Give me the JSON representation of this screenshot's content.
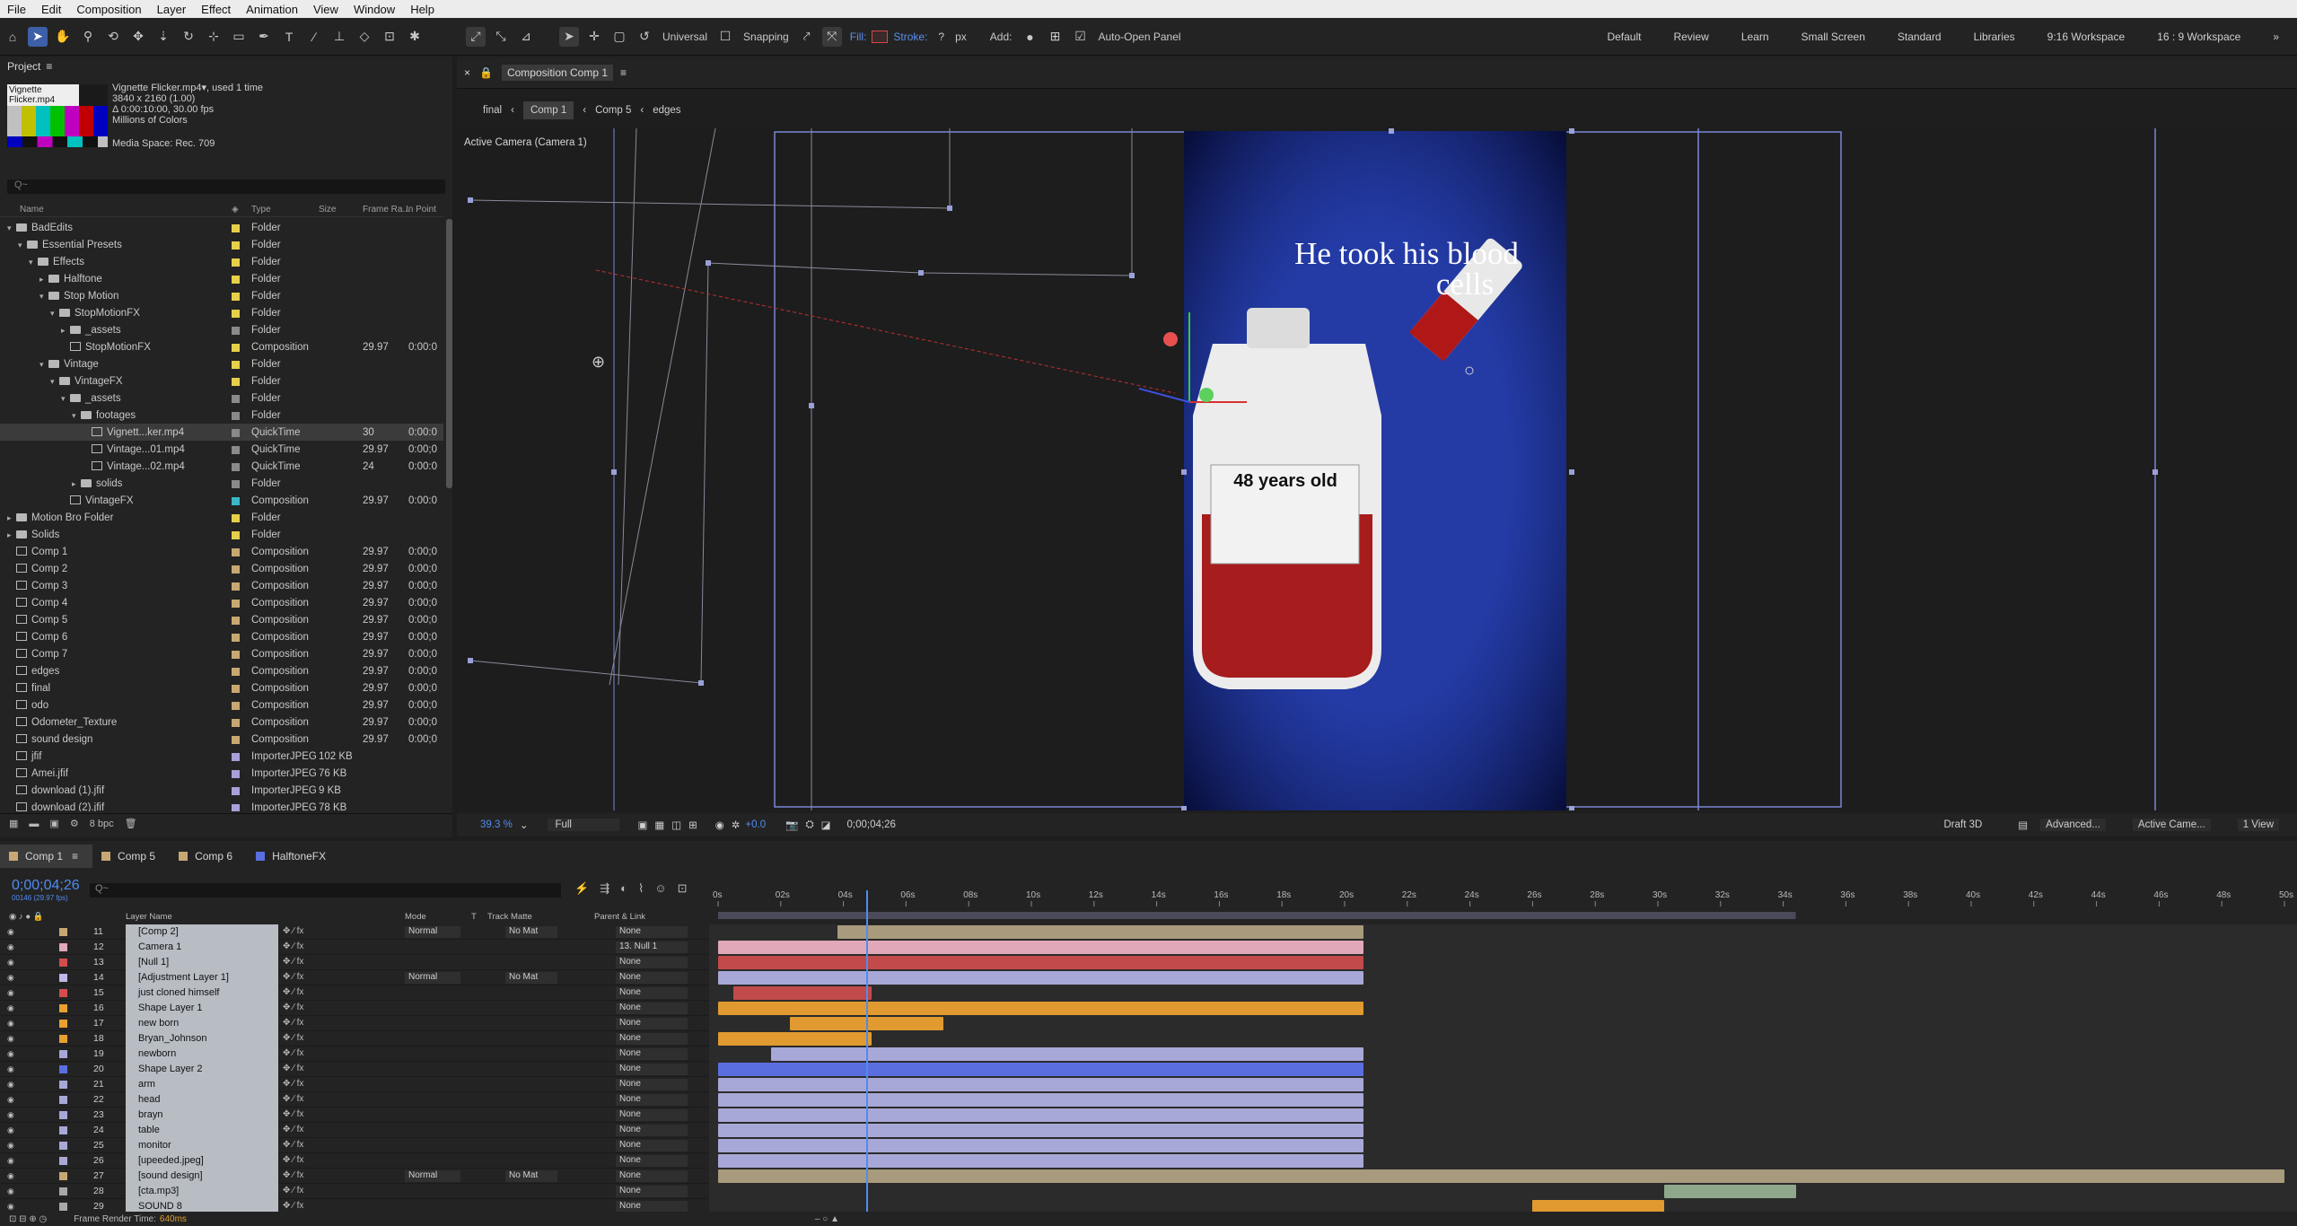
{
  "menu": [
    "File",
    "Edit",
    "Composition",
    "Layer",
    "Effect",
    "Animation",
    "View",
    "Window",
    "Help"
  ],
  "toolbar": {
    "universal": "Universal",
    "snapping": "Snapping",
    "fill": "Fill:",
    "stroke": "Stroke:",
    "stroke_val": "?",
    "px": "px",
    "add": "Add:",
    "auto_open": "Auto-Open Panel",
    "workspaces": [
      "Default",
      "Review",
      "Learn",
      "Small Screen",
      "Standard",
      "Libraries",
      "9:16 Workspace",
      "16 : 9 Workspace"
    ]
  },
  "project": {
    "title": "Project",
    "file_name": "Vignette Flicker.mp4",
    "used": ", used 1 time",
    "dims": "3840 x 2160 (1.00)",
    "duration": "Δ 0:00:10:00, 30.00 fps",
    "colors": "Millions of Colors",
    "media_space": "Media Space: Rec. 709",
    "search_placeholder": "Q~",
    "columns": [
      "Name",
      "Type",
      "Size",
      "Frame Ra...",
      "In Point"
    ],
    "bpc": "8 bpc",
    "items": [
      {
        "name": "BadEdits",
        "indent": 0,
        "tri": "▾",
        "kind": "folder",
        "type": "Folder",
        "size": "",
        "fps": "",
        "in": "",
        "color": "#e6d04a"
      },
      {
        "name": "Essential Presets",
        "indent": 1,
        "tri": "▾",
        "kind": "folder",
        "type": "Folder",
        "size": "",
        "fps": "",
        "in": "",
        "color": "#e6d04a"
      },
      {
        "name": "Effects",
        "indent": 2,
        "tri": "▾",
        "kind": "folder",
        "type": "Folder",
        "size": "",
        "fps": "",
        "in": "",
        "color": "#e6d04a"
      },
      {
        "name": "Halftone",
        "indent": 3,
        "tri": "▸",
        "kind": "folder",
        "type": "Folder",
        "size": "",
        "fps": "",
        "in": "",
        "color": "#e6d04a"
      },
      {
        "name": "Stop Motion",
        "indent": 3,
        "tri": "▾",
        "kind": "folder",
        "type": "Folder",
        "size": "",
        "fps": "",
        "in": "",
        "color": "#e6d04a"
      },
      {
        "name": "StopMotionFX",
        "indent": 4,
        "tri": "▾",
        "kind": "folder",
        "type": "Folder",
        "size": "",
        "fps": "",
        "in": "",
        "color": "#e6d04a"
      },
      {
        "name": "_assets",
        "indent": 5,
        "tri": "▸",
        "kind": "folder",
        "type": "Folder",
        "size": "",
        "fps": "",
        "in": "",
        "color": "#8a8a8a"
      },
      {
        "name": "StopMotionFX",
        "indent": 5,
        "tri": "",
        "kind": "comp",
        "type": "Composition",
        "size": "",
        "fps": "29.97",
        "in": "0:00:0",
        "color": "#e6d04a"
      },
      {
        "name": "Vintage",
        "indent": 3,
        "tri": "▾",
        "kind": "folder",
        "type": "Folder",
        "size": "",
        "fps": "",
        "in": "",
        "color": "#e6d04a"
      },
      {
        "name": "VintageFX",
        "indent": 4,
        "tri": "▾",
        "kind": "folder",
        "type": "Folder",
        "size": "",
        "fps": "",
        "in": "",
        "color": "#e6d04a"
      },
      {
        "name": "_assets",
        "indent": 5,
        "tri": "▾",
        "kind": "folder",
        "type": "Folder",
        "size": "",
        "fps": "",
        "in": "",
        "color": "#8a8a8a"
      },
      {
        "name": "footages",
        "indent": 6,
        "tri": "▾",
        "kind": "folder",
        "type": "Folder",
        "size": "",
        "fps": "",
        "in": "",
        "color": "#8a8a8a"
      },
      {
        "name": "Vignett...ker.mp4",
        "indent": 7,
        "tri": "",
        "kind": "comp",
        "type": "QuickTime",
        "size": "",
        "fps": "30",
        "in": "0:00:0",
        "color": "#8a8a8a",
        "selected": true
      },
      {
        "name": "Vintage...01.mp4",
        "indent": 7,
        "tri": "",
        "kind": "comp",
        "type": "QuickTime",
        "size": "",
        "fps": "29.97",
        "in": "0:00;0",
        "color": "#8a8a8a"
      },
      {
        "name": "Vintage...02.mp4",
        "indent": 7,
        "tri": "",
        "kind": "comp",
        "type": "QuickTime",
        "size": "",
        "fps": "24",
        "in": "0:00:0",
        "color": "#8a8a8a"
      },
      {
        "name": "solids",
        "indent": 6,
        "tri": "▸",
        "kind": "folder",
        "type": "Folder",
        "size": "",
        "fps": "",
        "in": "",
        "color": "#8a8a8a"
      },
      {
        "name": "VintageFX",
        "indent": 5,
        "tri": "",
        "kind": "comp",
        "type": "Composition",
        "size": "",
        "fps": "29.97",
        "in": "0:00:0",
        "color": "#3ab6c8"
      },
      {
        "name": "Motion Bro Folder",
        "indent": 0,
        "tri": "▸",
        "kind": "folder",
        "type": "Folder",
        "size": "",
        "fps": "",
        "in": "",
        "color": "#e6d04a"
      },
      {
        "name": "Solids",
        "indent": 0,
        "tri": "▸",
        "kind": "folder",
        "type": "Folder",
        "size": "",
        "fps": "",
        "in": "",
        "color": "#e6d04a"
      },
      {
        "name": "Comp 1",
        "indent": 0,
        "tri": "",
        "kind": "comp",
        "type": "Composition",
        "size": "",
        "fps": "29.97",
        "in": "0:00;0",
        "color": "#c8a872"
      },
      {
        "name": "Comp 2",
        "indent": 0,
        "tri": "",
        "kind": "comp",
        "type": "Composition",
        "size": "",
        "fps": "29.97",
        "in": "0:00;0",
        "color": "#c8a872"
      },
      {
        "name": "Comp 3",
        "indent": 0,
        "tri": "",
        "kind": "comp",
        "type": "Composition",
        "size": "",
        "fps": "29.97",
        "in": "0:00;0",
        "color": "#c8a872"
      },
      {
        "name": "Comp 4",
        "indent": 0,
        "tri": "",
        "kind": "comp",
        "type": "Composition",
        "size": "",
        "fps": "29.97",
        "in": "0:00;0",
        "color": "#c8a872"
      },
      {
        "name": "Comp 5",
        "indent": 0,
        "tri": "",
        "kind": "comp",
        "type": "Composition",
        "size": "",
        "fps": "29.97",
        "in": "0:00;0",
        "color": "#c8a872"
      },
      {
        "name": "Comp 6",
        "indent": 0,
        "tri": "",
        "kind": "comp",
        "type": "Composition",
        "size": "",
        "fps": "29.97",
        "in": "0:00;0",
        "color": "#c8a872"
      },
      {
        "name": "Comp 7",
        "indent": 0,
        "tri": "",
        "kind": "comp",
        "type": "Composition",
        "size": "",
        "fps": "29.97",
        "in": "0:00;0",
        "color": "#c8a872"
      },
      {
        "name": "edges",
        "indent": 0,
        "tri": "",
        "kind": "comp",
        "type": "Composition",
        "size": "",
        "fps": "29.97",
        "in": "0:00;0",
        "color": "#c8a872"
      },
      {
        "name": "final",
        "indent": 0,
        "tri": "",
        "kind": "comp",
        "type": "Composition",
        "size": "",
        "fps": "29.97",
        "in": "0:00;0",
        "color": "#c8a872"
      },
      {
        "name": "odo",
        "indent": 0,
        "tri": "",
        "kind": "comp",
        "type": "Composition",
        "size": "",
        "fps": "29.97",
        "in": "0:00;0",
        "color": "#c8a872"
      },
      {
        "name": "Odometer_Texture",
        "indent": 0,
        "tri": "",
        "kind": "comp",
        "type": "Composition",
        "size": "",
        "fps": "29.97",
        "in": "0:00;0",
        "color": "#c8a872"
      },
      {
        "name": "sound design",
        "indent": 0,
        "tri": "",
        "kind": "comp",
        "type": "Composition",
        "size": "",
        "fps": "29.97",
        "in": "0:00;0",
        "color": "#c8a872"
      },
      {
        "name": "jfif",
        "indent": 0,
        "tri": "",
        "kind": "comp",
        "type": "ImporterJPEG",
        "size": "102 KB",
        "fps": "",
        "in": "",
        "color": "#a8a0d8"
      },
      {
        "name": "Amei.jfif",
        "indent": 0,
        "tri": "",
        "kind": "comp",
        "type": "ImporterJPEG",
        "size": "76 KB",
        "fps": "",
        "in": "",
        "color": "#a8a0d8"
      },
      {
        "name": "download (1).jfif",
        "indent": 0,
        "tri": "",
        "kind": "comp",
        "type": "ImporterJPEG",
        "size": "9 KB",
        "fps": "",
        "in": "",
        "color": "#a8a0d8"
      },
      {
        "name": "download (2).jfif",
        "indent": 0,
        "tri": "",
        "kind": "comp",
        "type": "ImporterJPEG",
        "size": "78 KB",
        "fps": "",
        "in": "",
        "color": "#a8a0d8"
      }
    ]
  },
  "composition": {
    "panel_title": "Composition Comp 1",
    "breadcrumbs": [
      "final",
      "Comp 1",
      "Comp 5",
      "edges"
    ],
    "active_camera": "Active Camera (Camera 1)",
    "overlay_text_1": "He took his blood",
    "overlay_text_2": "cells",
    "bag_label": "48 years old",
    "zoom": "39.3 %",
    "resolution": "Full",
    "timecode": "0;00;04;26",
    "exposure": "+0.0",
    "draft": "Draft 3D",
    "renderer": "Advanced...",
    "camera": "Active Came...",
    "view": "1 View"
  },
  "timeline": {
    "tabs": [
      {
        "label": "Comp 1",
        "color": "#c8a872"
      },
      {
        "label": "Comp 5",
        "color": "#c8a872"
      },
      {
        "label": "Comp 6",
        "color": "#c8a872"
      },
      {
        "label": "HalftoneFX",
        "color": "#5a6ee0"
      }
    ],
    "timecode": "0;00;04;26",
    "timecode_sub": "00146 (29.97 fps)",
    "search_placeholder": "Q~",
    "headers": {
      "layer_name": "Layer Name",
      "mode": "Mode",
      "t": "T",
      "track_matte": "Track Matte",
      "parent": "Parent & Link"
    },
    "ruler": [
      "0s",
      "02s",
      "04s",
      "06s",
      "08s",
      "10s",
      "12s",
      "14s",
      "16s",
      "18s",
      "20s",
      "22s",
      "24s",
      "26s",
      "28s",
      "30s",
      "32s",
      "34s",
      "36s",
      "38s",
      "40s",
      "42s",
      "44s",
      "46s",
      "48s",
      "50s"
    ],
    "footer": "Frame Render Time:",
    "render_time": "640ms",
    "layers": [
      {
        "num": "11",
        "name": "[Comp 2]",
        "label": "#c8a872",
        "mode": "Normal",
        "tm": "No Mat",
        "parent": "None",
        "bar": {
          "s": 3.8,
          "e": 20.6,
          "c": "#a89a7c"
        }
      },
      {
        "num": "12",
        "name": "Camera 1",
        "label": "#e0a8b8",
        "mode": "",
        "tm": "",
        "parent": "13. Null 1",
        "bar": {
          "s": 0,
          "e": 20.6,
          "c": "#e0a8b8"
        }
      },
      {
        "num": "13",
        "name": "[Null 1]",
        "label": "#d44c4c",
        "mode": "",
        "tm": "",
        "parent": "None",
        "bar": {
          "s": 0,
          "e": 20.6,
          "c": "#c24a4a"
        }
      },
      {
        "num": "14",
        "name": "[Adjustment Layer 1]",
        "label": "#c0b8e8",
        "mode": "Normal",
        "tm": "No Mat",
        "parent": "None",
        "bar": {
          "s": 0,
          "e": 20.6,
          "c": "#a8a8d8"
        }
      },
      {
        "num": "15",
        "name": "just cloned himself",
        "label": "#d44c4c",
        "mode": "",
        "tm": "",
        "parent": "None",
        "bar": {
          "s": 0.5,
          "e": 4.9,
          "c": "#c24a4a"
        }
      },
      {
        "num": "16",
        "name": "Shape Layer 1",
        "label": "#e8a030",
        "mode": "",
        "tm": "",
        "parent": "None",
        "bar": {
          "s": 0,
          "e": 20.6,
          "c": "#e09a30"
        }
      },
      {
        "num": "17",
        "name": "new born",
        "label": "#e8a030",
        "mode": "",
        "tm": "",
        "parent": "None",
        "bar": {
          "s": 2.3,
          "e": 7.2,
          "c": "#e09a30"
        }
      },
      {
        "num": "18",
        "name": "Bryan_Johnson",
        "label": "#e8a030",
        "mode": "",
        "tm": "",
        "parent": "None",
        "bar": {
          "s": 0,
          "e": 4.9,
          "c": "#e09a30"
        }
      },
      {
        "num": "19",
        "name": "newborn",
        "label": "#a8a8d8",
        "mode": "",
        "tm": "",
        "parent": "None",
        "bar": {
          "s": 1.7,
          "e": 20.6,
          "c": "#a8a8d8"
        }
      },
      {
        "num": "20",
        "name": "Shape Layer 2",
        "label": "#5a6ee0",
        "mode": "",
        "tm": "",
        "parent": "None",
        "bar": {
          "s": 0,
          "e": 20.6,
          "c": "#5a6ee0"
        }
      },
      {
        "num": "21",
        "name": "arm",
        "label": "#a8a8d8",
        "mode": "",
        "tm": "",
        "parent": "None",
        "bar": {
          "s": 0,
          "e": 20.6,
          "c": "#a8a8d8"
        }
      },
      {
        "num": "22",
        "name": "head",
        "label": "#a8a8d8",
        "mode": "",
        "tm": "",
        "parent": "None",
        "bar": {
          "s": 0,
          "e": 20.6,
          "c": "#a8a8d8"
        }
      },
      {
        "num": "23",
        "name": "brayn",
        "label": "#a8a8d8",
        "mode": "",
        "tm": "",
        "parent": "None",
        "bar": {
          "s": 0,
          "e": 20.6,
          "c": "#a8a8d8"
        }
      },
      {
        "num": "24",
        "name": "table",
        "label": "#a8a8d8",
        "mode": "",
        "tm": "",
        "parent": "None",
        "bar": {
          "s": 0,
          "e": 20.6,
          "c": "#a8a8d8"
        }
      },
      {
        "num": "25",
        "name": "monitor",
        "label": "#a8a8d8",
        "mode": "",
        "tm": "",
        "parent": "None",
        "bar": {
          "s": 0,
          "e": 20.6,
          "c": "#a8a8d8"
        }
      },
      {
        "num": "26",
        "name": "[upeeded.jpeg]",
        "label": "#a8a8d8",
        "mode": "",
        "tm": "",
        "parent": "None",
        "bar": {
          "s": 0,
          "e": 20.6,
          "c": "#a8a8d8"
        }
      },
      {
        "num": "27",
        "name": "[sound design]",
        "label": "#c8a872",
        "mode": "Normal",
        "tm": "No Mat",
        "parent": "None",
        "bar": {
          "s": 0,
          "e": 50,
          "c": "#a89a7c"
        }
      },
      {
        "num": "28",
        "name": "[cta.mp3]",
        "label": "#a8a8a8",
        "mode": "",
        "tm": "",
        "parent": "None",
        "bar": {
          "s": 30.2,
          "e": 34.4,
          "c": "#8fa88c"
        }
      },
      {
        "num": "29",
        "name": "SOUND 8",
        "label": "#a8a8a8",
        "mode": "",
        "tm": "",
        "parent": "None",
        "bar": {
          "s": 26,
          "e": 30.2,
          "c": "#e09a30"
        }
      }
    ]
  }
}
